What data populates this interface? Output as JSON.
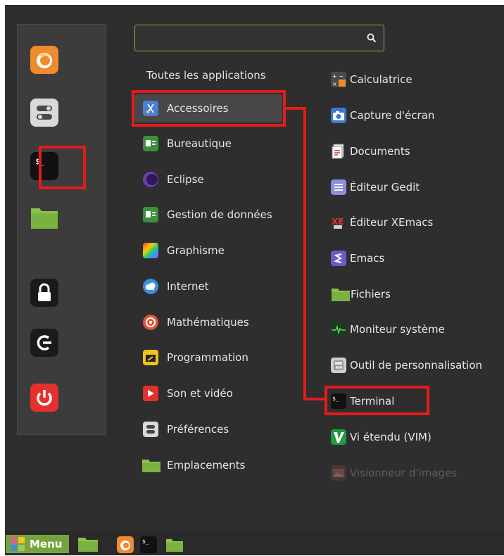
{
  "search": {
    "value": "",
    "placeholder": "",
    "icon": "search-icon"
  },
  "favorites": [
    {
      "name": "firefox-icon"
    },
    {
      "name": "settings-icon"
    },
    {
      "name": "terminal-icon"
    },
    {
      "name": "folder-icon"
    },
    {
      "name": "lock-icon"
    },
    {
      "name": "logout-icon"
    },
    {
      "name": "power-icon"
    }
  ],
  "categories": {
    "header": "Toutes les applications",
    "items": [
      {
        "label": "Accessoires",
        "icon": "scissors-icon"
      },
      {
        "label": "Bureautique",
        "icon": "office-icon"
      },
      {
        "label": "Eclipse",
        "icon": "eclipse-icon"
      },
      {
        "label": "Gestion de données",
        "icon": "database-icon"
      },
      {
        "label": "Graphisme",
        "icon": "graphics-icon"
      },
      {
        "label": "Internet",
        "icon": "cloud-icon"
      },
      {
        "label": "Mathématiques",
        "icon": "math-icon"
      },
      {
        "label": "Programmation",
        "icon": "programming-icon"
      },
      {
        "label": "Son et vidéo",
        "icon": "play-icon"
      },
      {
        "label": "Préférences",
        "icon": "preferences-icon"
      },
      {
        "label": "Emplacements",
        "icon": "folder-icon"
      }
    ]
  },
  "applications": [
    {
      "label": "Calculatrice",
      "icon": "calculator-icon"
    },
    {
      "label": "Capture d'écran",
      "icon": "camera-icon"
    },
    {
      "label": "Documents",
      "icon": "documents-icon"
    },
    {
      "label": "Éditeur Gedit",
      "icon": "text-editor-icon"
    },
    {
      "label": "Éditeur XEmacs",
      "icon": "xemacs-icon"
    },
    {
      "label": "Emacs",
      "icon": "emacs-icon"
    },
    {
      "label": "Fichiers",
      "icon": "folder-icon"
    },
    {
      "label": "Moniteur système",
      "icon": "monitor-icon"
    },
    {
      "label": "Outil de personnalisation",
      "icon": "tweak-icon"
    },
    {
      "label": "Terminal",
      "icon": "terminal-icon"
    },
    {
      "label": "Vi étendu (VIM)",
      "icon": "vim-icon"
    },
    {
      "label": "Visionneur d'images",
      "icon": "image-viewer-icon"
    }
  ],
  "terminal_prompt": "$_",
  "panel": {
    "menu_label": "Menu",
    "launchers": [
      "folder-icon",
      "firefox-icon",
      "terminal-icon",
      "folder-icon"
    ]
  },
  "colors": {
    "accent": "#86b04a",
    "highlight": "#e51b1b",
    "menu_bg": "#2e2e2e"
  }
}
